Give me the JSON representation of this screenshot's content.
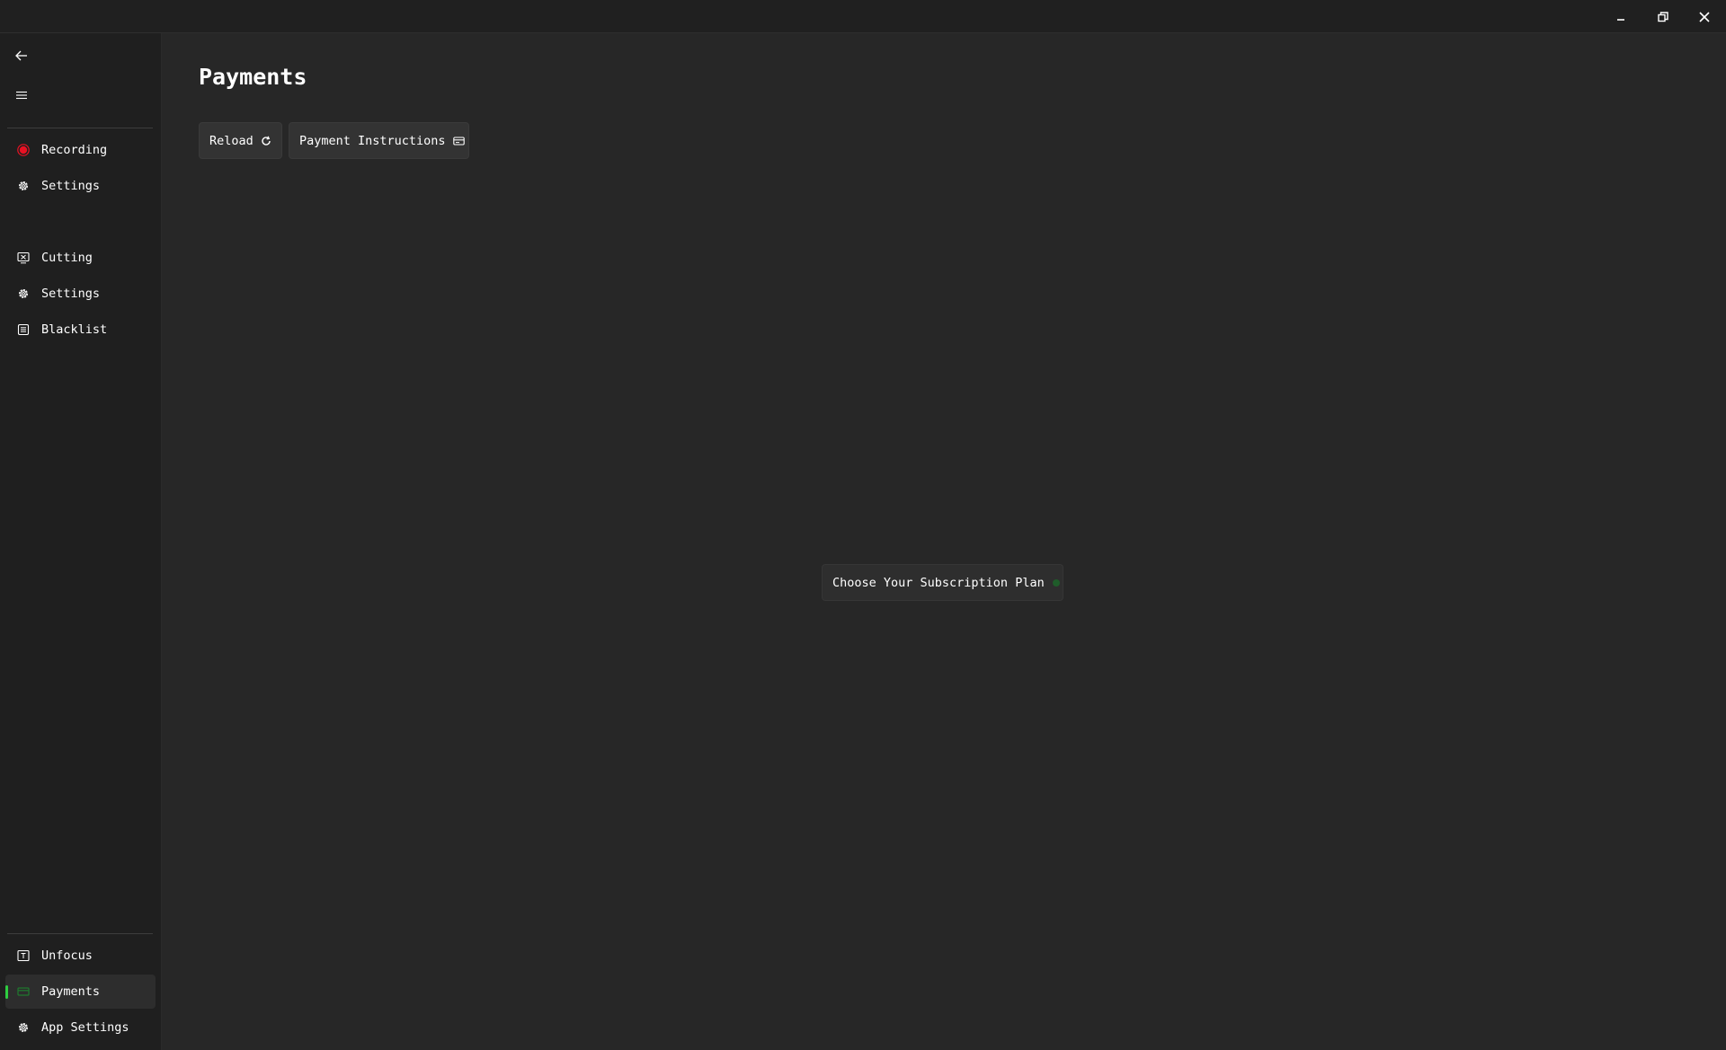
{
  "titlebar": {
    "controls": [
      {
        "name": "minimize",
        "icon": "minimize-icon"
      },
      {
        "name": "restore",
        "icon": "restore-icon"
      },
      {
        "name": "close",
        "icon": "close-icon"
      }
    ]
  },
  "sidebar": {
    "back_icon": "arrow-left-icon",
    "menu_icon": "hamburger-menu-icon",
    "groups": [
      {
        "items": [
          {
            "label": "Recording",
            "icon": "record-dot-icon",
            "icon_color": "#e81123"
          },
          {
            "label": "Settings",
            "icon": "gear-icon"
          }
        ]
      },
      {
        "items": [
          {
            "label": "Cutting",
            "icon": "cut-screen-icon"
          },
          {
            "label": "Settings",
            "icon": "gear-icon"
          },
          {
            "label": "Blacklist",
            "icon": "list-box-icon"
          }
        ]
      }
    ],
    "footer_items": [
      {
        "label": "Unfocus",
        "icon": "unfocus-icon"
      },
      {
        "label": "Payments",
        "icon": "payment-card-icon",
        "icon_color": "#1f7a2e",
        "active": true
      },
      {
        "label": "App Settings",
        "icon": "gear-icon"
      }
    ],
    "active_indicator_color": "#2ecc40"
  },
  "main": {
    "title": "Payments",
    "toolbar": {
      "reload_label": "Reload",
      "reload_icon": "refresh-icon",
      "instructions_label": "Payment Instructions",
      "instructions_icon": "card-icon"
    },
    "plan_button": {
      "label": "Choose Your Subscription Plan",
      "icon": "dot-icon",
      "icon_color": "#1f5c2a"
    }
  }
}
